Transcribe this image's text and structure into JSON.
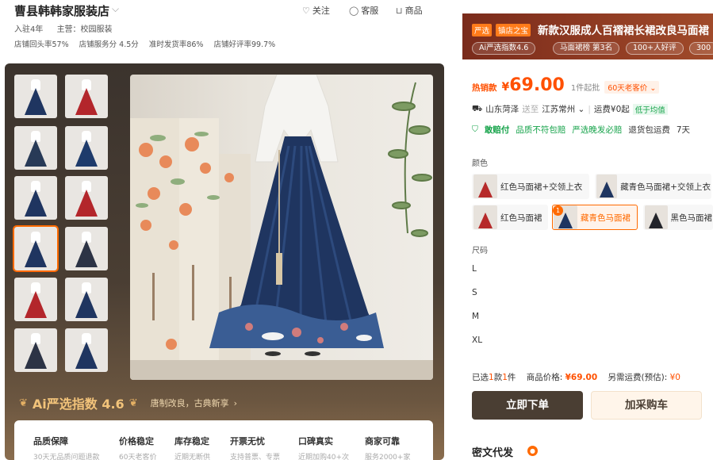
{
  "store": {
    "name": "曹县韩韩家服装店",
    "actions": {
      "follow": "关注",
      "service": "客服",
      "products": "商品"
    },
    "tenure": "入驻4年",
    "category": "主营：校园服装",
    "stats": [
      "店铺回头率57%",
      "店铺服务分 4.5分",
      "准时发货率86%",
      "店铺好评率99.7%"
    ]
  },
  "gallery": {
    "ai_score": "Ai严选指数 4.6",
    "slogan": "唐制改良，古典新享",
    "thumb_colors": [
      "#1f3560",
      "#b3262b",
      "#283a57",
      "#1e3b6b",
      "#1f3560",
      "#b3262b",
      "#1f3560",
      "#2c3345",
      "#b3262b",
      "#1f3560",
      "#2c3345",
      "#1f3560"
    ]
  },
  "guarantees": [
    {
      "title": "品质保障",
      "sub": "30天无品质问题退款"
    },
    {
      "title": "价格稳定",
      "sub": "60天老客价"
    },
    {
      "title": "库存稳定",
      "sub": "近期无断供"
    },
    {
      "title": "开票无忧",
      "sub": "支持普票、专票"
    },
    {
      "title": "口碑真实",
      "sub": "近期加购40+次"
    },
    {
      "title": "商家可靠",
      "sub": "服务2000+家"
    }
  ],
  "product": {
    "tags": [
      "严选",
      "镇店之宝"
    ],
    "title": "新款汉服成人百褶裙长裙改良马面裙",
    "pills": [
      "Ai严选指数4.6",
      "马面裙榜 第3名",
      "100+人好评",
      "300"
    ],
    "price_label": "热销款",
    "price_symbol": "¥",
    "price": "69.00",
    "min_qty": "1件起批",
    "price_badge": "60天老客价 ⌄",
    "ship_from": "山东菏泽",
    "ship_to_label": "送至",
    "ship_to": "江苏常州 ⌄",
    "freight": "运费¥0起",
    "freight_tag": "低于均值",
    "services": [
      "敢赔付",
      "品质不符包赔",
      "严选晚发必赔",
      "退货包运费",
      "7天"
    ],
    "color_label": "颜色",
    "colors": [
      {
        "label": "红色马面裙+交领上衣",
        "swatch": "#b62a2a"
      },
      {
        "label": "藏青色马面裙+交领上衣",
        "swatch": "#1f3560"
      },
      {
        "label": "红色马面裙",
        "swatch": "#b62a2a"
      },
      {
        "label": "藏青色马面裙",
        "swatch": "#1f3560",
        "selected_count": "1"
      },
      {
        "label": "黑色马面裙",
        "swatch": "#23242a"
      }
    ],
    "size_label": "尺码",
    "sizes": [
      "L",
      "S",
      "M",
      "XL"
    ],
    "summary": {
      "selected_prefix": "已选",
      "kinds": "1",
      "kinds_unit": "款",
      "pieces": "1",
      "pieces_unit": "件",
      "goods_label": "商品价格:",
      "goods_price": "¥69.00",
      "freight_label": "另需运费(预估):",
      "freight_price": "¥0"
    },
    "buy_now": "立即下单",
    "add_cart": "加采购车"
  },
  "secret": {
    "title": "密文代发"
  }
}
